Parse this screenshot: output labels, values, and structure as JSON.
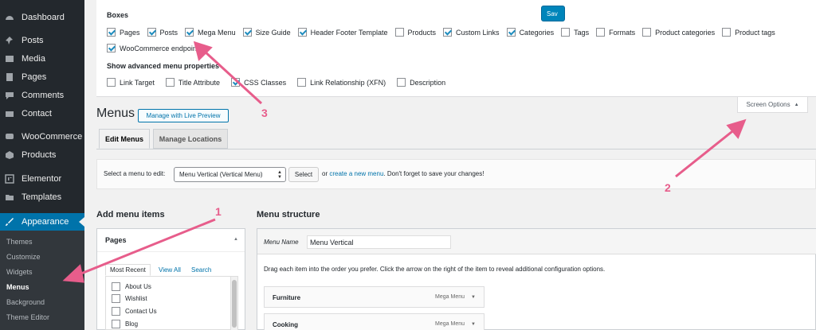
{
  "sidebar": {
    "items": [
      {
        "label": "Dashboard",
        "icon": "dashboard-icon"
      },
      {
        "label": "Posts",
        "icon": "pin-icon"
      },
      {
        "label": "Media",
        "icon": "media-icon"
      },
      {
        "label": "Pages",
        "icon": "pages-icon"
      },
      {
        "label": "Comments",
        "icon": "comments-icon"
      },
      {
        "label": "Contact",
        "icon": "mail-icon"
      },
      {
        "label": "WooCommerce",
        "icon": "woocommerce-icon"
      },
      {
        "label": "Products",
        "icon": "products-icon"
      },
      {
        "label": "Elementor",
        "icon": "elementor-icon"
      },
      {
        "label": "Templates",
        "icon": "folder-icon"
      },
      {
        "label": "Appearance",
        "icon": "brush-icon",
        "active": true
      }
    ],
    "submenu": [
      "Themes",
      "Customize",
      "Widgets",
      "Menus",
      "Background",
      "Theme Editor"
    ],
    "current_submenu": "Menus"
  },
  "screen_options": {
    "boxes_heading": "Boxes",
    "boxes": [
      {
        "label": "Pages",
        "checked": true
      },
      {
        "label": "Posts",
        "checked": true
      },
      {
        "label": "Mega Menu",
        "checked": true
      },
      {
        "label": "Size Guide",
        "checked": true
      },
      {
        "label": "Header Footer Template",
        "checked": true
      },
      {
        "label": "Products",
        "checked": false
      },
      {
        "label": "Custom Links",
        "checked": true
      },
      {
        "label": "Categories",
        "checked": true
      },
      {
        "label": "Tags",
        "checked": false
      },
      {
        "label": "Formats",
        "checked": false
      },
      {
        "label": "Product categories",
        "checked": false
      },
      {
        "label": "Product tags",
        "checked": false
      },
      {
        "label": "WooCommerce endpoints",
        "checked": true
      }
    ],
    "advanced_heading": "Show advanced menu properties",
    "advanced": [
      {
        "label": "Link Target",
        "checked": false
      },
      {
        "label": "Title Attribute",
        "checked": false
      },
      {
        "label": "CSS Classes",
        "checked": true
      },
      {
        "label": "Link Relationship (XFN)",
        "checked": false
      },
      {
        "label": "Description",
        "checked": false
      }
    ],
    "tab_label": "Screen Options"
  },
  "header": {
    "title": "Menus",
    "live_preview_label": "Manage with Live Preview"
  },
  "tabs": [
    {
      "label": "Edit Menus",
      "active": true
    },
    {
      "label": "Manage Locations",
      "active": false
    }
  ],
  "select_bar": {
    "label": "Select a menu to edit:",
    "selected": "Menu Vertical (Vertical Menu)",
    "button": "Select",
    "hint_prefix": "or",
    "hint_link": "create a new menu",
    "hint_suffix": ". Don't forget to save your changes!"
  },
  "add_items": {
    "title": "Add menu items",
    "box_title": "Pages",
    "tabs": [
      "Most Recent",
      "View All",
      "Search"
    ],
    "pages": [
      "About Us",
      "Wishlist",
      "Contact Us",
      "Blog"
    ]
  },
  "structure": {
    "title": "Menu structure",
    "name_label": "Menu Name",
    "name_value": "Menu Vertical",
    "save_label": "Sav",
    "hint": "Drag each item into the order you prefer. Click the arrow on the right of the item to reveal additional configuration options.",
    "items": [
      {
        "title": "Furniture",
        "type": "Mega Menu"
      },
      {
        "title": "Cooking",
        "type": "Mega Menu"
      }
    ]
  },
  "annotations": [
    "1",
    "2",
    "3"
  ],
  "colors": {
    "sidebar_bg": "#23282d",
    "active_blue": "#0073aa",
    "annotation_pink": "#e75d8b"
  }
}
